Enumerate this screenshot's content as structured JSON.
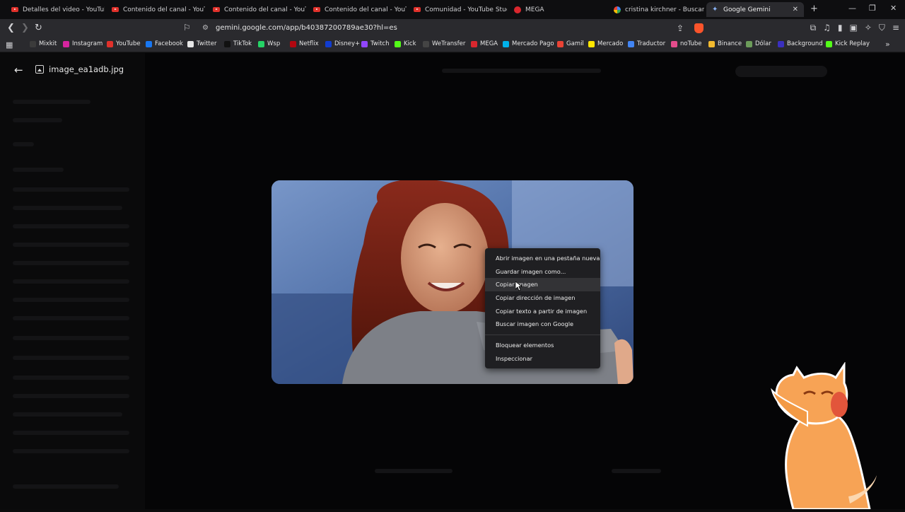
{
  "tabs": [
    {
      "label": "Detalles del video - YouTube St",
      "icon": "youtube-icon"
    },
    {
      "label": "Contenido del canal - YouTube",
      "icon": "youtube-icon"
    },
    {
      "label": "Contenido del canal - YouTube",
      "icon": "youtube-icon"
    },
    {
      "label": "Contenido del canal - YouTube",
      "icon": "youtube-icon"
    },
    {
      "label": "Comunidad - YouTube Studio",
      "icon": "youtube-icon"
    },
    {
      "label": "MEGA",
      "icon": "mega-icon"
    },
    {
      "label": "cristina kirchner - Buscar con G",
      "icon": "google-icon"
    },
    {
      "label": "Google Gemini",
      "icon": "gemini-icon"
    }
  ],
  "address": {
    "url": "gemini.google.com/app/b40387200789ae30?hl=es"
  },
  "bookmarks": [
    {
      "label": "Mixkit",
      "color": "#3b3b3b"
    },
    {
      "label": "Instagram",
      "color": "#d6249f"
    },
    {
      "label": "YouTube",
      "color": "#e0312b"
    },
    {
      "label": "Facebook",
      "color": "#1877f2"
    },
    {
      "label": "Twitter",
      "color": "#e6e6e6"
    },
    {
      "label": "TikTok",
      "color": "#111111"
    },
    {
      "label": "Wsp",
      "color": "#25d366"
    },
    {
      "label": "Netflix",
      "color": "#b20710"
    },
    {
      "label": "Disney+",
      "color": "#113ccf"
    },
    {
      "label": "Twitch",
      "color": "#9146ff"
    },
    {
      "label": "Kick",
      "color": "#53fc18"
    },
    {
      "label": "WeTransfer",
      "color": "#444444"
    },
    {
      "label": "MEGA",
      "color": "#d9272e"
    },
    {
      "label": "Mercado Pago",
      "color": "#00b1ea"
    },
    {
      "label": "Gamil",
      "color": "#ea4335"
    },
    {
      "label": "Mercado",
      "color": "#ffe600"
    },
    {
      "label": "Traductor",
      "color": "#4285f4"
    },
    {
      "label": "noTube",
      "color": "#e44c8c"
    },
    {
      "label": "Binance",
      "color": "#f3ba2f"
    },
    {
      "label": "Dólar",
      "color": "#6c9c5a"
    },
    {
      "label": "Background",
      "color": "#3a2fbf"
    },
    {
      "label": "Kick Replay",
      "color": "#53fc18"
    }
  ],
  "viewer": {
    "file_name": "image_ea1adb.jpg"
  },
  "context_menu": {
    "items": [
      "Abrir imagen en una pestaña nueva",
      "Guardar imagen como...",
      "Copiar imagen",
      "Copiar dirección de imagen",
      "Copiar texto a partir de imagen",
      "Buscar imagen con Google"
    ],
    "items2": [
      "Bloquear elementos",
      "Inspeccionar"
    ],
    "hovered_index": 2
  }
}
